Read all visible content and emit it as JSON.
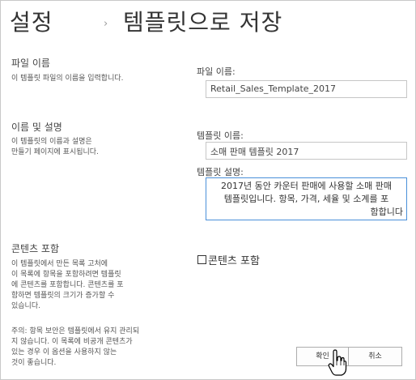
{
  "header": {
    "breadcrumb_root": "설정",
    "separator": "›",
    "page_title": "템플릿으로 저장"
  },
  "sections": {
    "file_name": {
      "title": "파일 이름",
      "description": "이 템플릿 파일의 이름을 입력합니다.",
      "field_label": "파일 이름:",
      "field_value": "Retail_Sales_Template_2017"
    },
    "name_desc": {
      "title": "이름 및 설명",
      "description_lines": [
        "이 템플릿의 이름과 설명은",
        "만들기 페이지에 표시됩니다."
      ],
      "name_label": "템플릿 이름:",
      "name_value": "소매 판매 템플릿 2017",
      "desc_label": "템플릿 설명:",
      "desc_lines": [
        "2017년 동안 카운터 판매에 사용할 소매 판매",
        "템플릿입니다. 항목, 가격, 세율 및 소계를 포",
        "함합니다"
      ]
    },
    "content": {
      "title": "콘텐츠 포함",
      "description_lines": [
        "이 템플릿에서 만든 목록 고처에",
        "이 목록에 항목을 포함하려면 템플릿",
        "에 콘텐츠를 포함합니다. 콘텐츠를 포",
        "함하면 템플릿의 크기가 증가할 수",
        "있습니다."
      ],
      "note_lines": [
        "주의: 항목 보안은 템플릿에서 유지 관리되",
        "지 않습니다. 이 목록에 비공개 콘텐츠가",
        "있는 경우 이 옵션을 사용하지 않는",
        "것이 좋습니다."
      ],
      "checkbox_label": "콘텐츠 포함",
      "checkbox_checked": false
    }
  },
  "buttons": {
    "ok": "확인",
    "cancel": "취소"
  }
}
